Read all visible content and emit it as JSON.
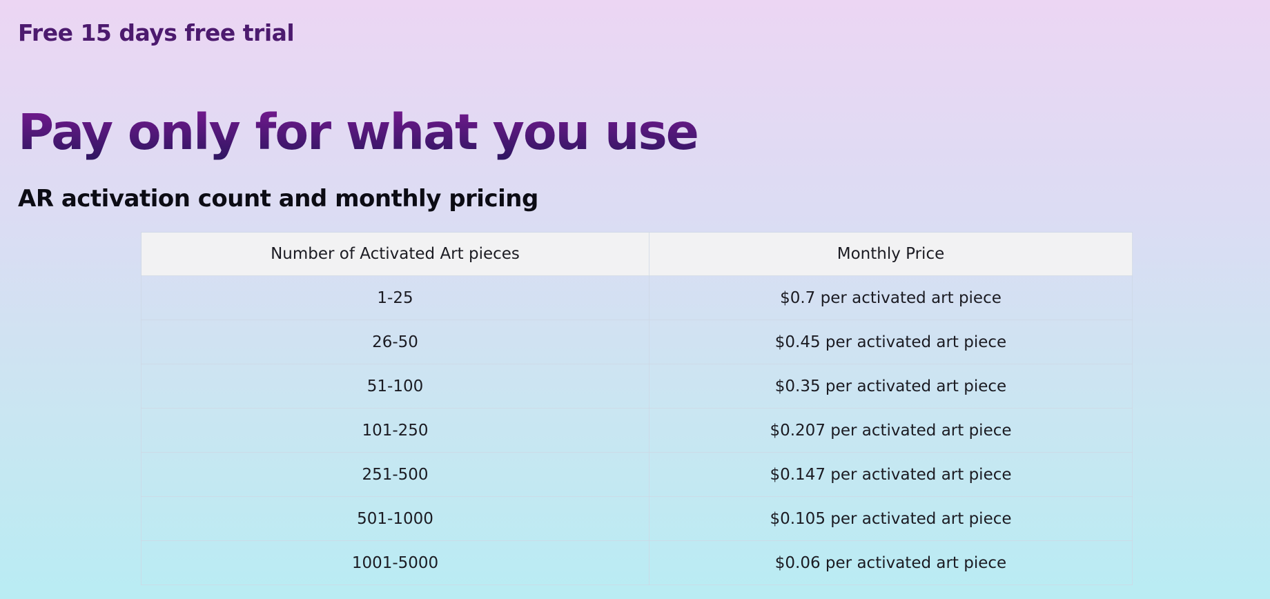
{
  "trial_banner": "Free 15 days free trial",
  "headline": "Pay only for what you use",
  "subheadline": "AR activation count and monthly pricing",
  "table": {
    "headers": [
      "Number of Activated Art pieces",
      "Monthly Price"
    ],
    "rows": [
      [
        "1-25",
        "$0.7 per activated art piece"
      ],
      [
        "26-50",
        "$0.45 per activated art piece"
      ],
      [
        "51-100",
        "$0.35 per activated art piece"
      ],
      [
        "101-250",
        "$0.207 per activated art piece"
      ],
      [
        "251-500",
        "$0.147 per activated art piece"
      ],
      [
        "501-1000",
        "$0.105 per activated art piece"
      ],
      [
        "1001-5000",
        "$0.06 per activated art piece"
      ]
    ]
  },
  "colors": {
    "trial_text": "#4c1a6e",
    "headline_top": "#7a1a92",
    "headline_bottom": "#2c1660",
    "header_bg": "#f2f2f3"
  }
}
